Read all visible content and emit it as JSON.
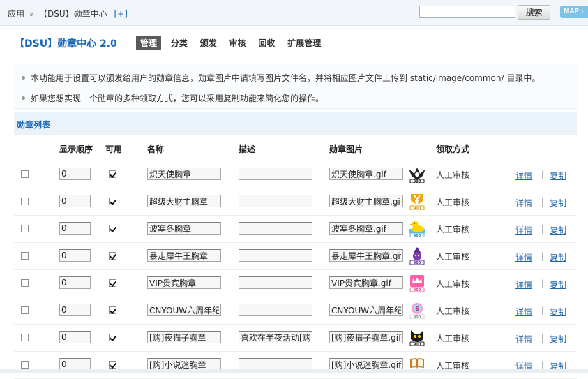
{
  "topbar": {
    "crumb_app": "应用",
    "crumb_sep": "»",
    "crumb_current": "【DSU】勋章中心",
    "crumb_add": "[+]",
    "search_value": "",
    "search_button": "搜索",
    "map_button": "MAP"
  },
  "header": {
    "title": "【DSU】勋章中心  2.0",
    "tabs": [
      "管理",
      "分类",
      "颁发",
      "审核",
      "回收",
      "扩展管理"
    ]
  },
  "tips": [
    "本功能用于设置可以颁发给用户的勋章信息，勋章图片中请填写图片文件名，并将相应图片文件上传到 static/image/common/ 目录中。",
    "如果您想实现一个勋章的多种领取方式，您可以采用复制功能来简化您的操作。"
  ],
  "section_title": "勋章列表",
  "table": {
    "headers": {
      "order": "显示顺序",
      "enabled": "可用",
      "name": "名称",
      "desc": "描述",
      "image": "勋章图片",
      "method": "领取方式"
    },
    "link_detail": "详情",
    "link_sep": "|",
    "link_copy": "复制",
    "rows": [
      {
        "order": "0",
        "enabled": true,
        "name": "炽天使胸章",
        "desc": "",
        "image": "炽天使胸章.gif",
        "method": "人工审核",
        "icon": "wings-badge-icon"
      },
      {
        "order": "0",
        "enabled": true,
        "name": "超级大财主胸章",
        "desc": "",
        "image": "超级大财主胸章.gif",
        "method": "人工审核",
        "icon": "yen-badge-icon"
      },
      {
        "order": "0",
        "enabled": true,
        "name": "波塞冬胸章",
        "desc": "",
        "image": "波塞冬胸章.gif",
        "method": "人工审核",
        "icon": "duck-badge-icon"
      },
      {
        "order": "0",
        "enabled": true,
        "name": "暴走犀牛王胸章",
        "desc": "",
        "image": "暴走犀牛王胸章.gif",
        "method": "人工审核",
        "icon": "witch-badge-icon"
      },
      {
        "order": "0",
        "enabled": true,
        "name": "VIP贵宾胸章",
        "desc": "",
        "image": "VIP贵宾胸章.gif",
        "method": "人工审核",
        "icon": "crown-badge-icon"
      },
      {
        "order": "0",
        "enabled": true,
        "name": "CNYOUW六周年纪",
        "desc": "",
        "image": "CNYOUW六周年纪",
        "method": "人工审核",
        "icon": "anniversary-badge-icon"
      },
      {
        "order": "0",
        "enabled": true,
        "name": "[购]夜猫子胸章",
        "desc": "喜欢在半夜活动[购]",
        "image": "[购]夜猫子胸章.gif",
        "method": "人工审核",
        "icon": "cat-badge-icon"
      },
      {
        "order": "0",
        "enabled": true,
        "name": "[购]小说迷胸章",
        "desc": "",
        "image": "[购]小说迷胸章.gif",
        "method": "人工审核",
        "icon": "book-badge-icon"
      }
    ]
  },
  "colors": {
    "accent": "#1b69b6",
    "link": "#2366a8",
    "section_bg": "#eaf3fa"
  }
}
